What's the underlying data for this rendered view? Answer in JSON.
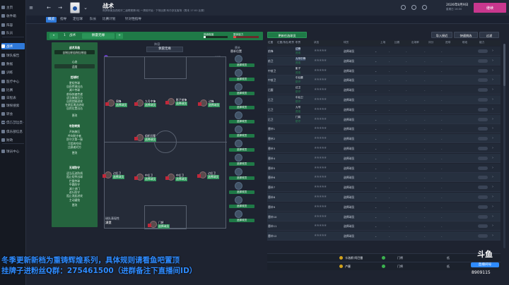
{
  "sidebar": {
    "items": [
      {
        "label": "主页",
        "active": false
      },
      {
        "label": "收件箱",
        "active": false
      },
      {
        "label": "阵容",
        "active": false
      },
      {
        "label": "队员",
        "active": false
      },
      {
        "label": "战术",
        "active": true
      },
      {
        "label": "球队报告",
        "active": false
      },
      {
        "label": "数据",
        "active": false
      },
      {
        "label": "训练",
        "active": false
      },
      {
        "label": "医疗中心",
        "active": false
      },
      {
        "label": "比赛",
        "active": false
      },
      {
        "label": "日程表",
        "active": false
      },
      {
        "label": "球探搜索",
        "active": false
      },
      {
        "label": "转会",
        "active": false
      },
      {
        "label": "俱乐部远景",
        "active": false
      },
      {
        "label": "俱乐部信息",
        "active": false
      },
      {
        "label": "财政",
        "active": false
      },
      {
        "label": "球员中心",
        "active": false
      }
    ]
  },
  "header": {
    "title": "战术",
    "subtitle": "佩罗斯莱加西班牙二级联赛第1轮 一周前开始 · 下场比赛 科尔多瓦客场（周末 17:00 比赛）",
    "date_main": "2026年8月9日",
    "date_sub": "星期日 16:00",
    "continue_label": "继续"
  },
  "subnav": {
    "tabs": [
      "概览",
      "指导",
      "定位球",
      "队长",
      "比赛计划",
      "针对性指导"
    ],
    "active_index": 0
  },
  "formbar": {
    "collapse_icon": "«",
    "slot_num": "1",
    "slot_name": "战术",
    "formation_label": "佩雷无缘",
    "add_icon": "+",
    "meter_label_1": "熟悉程度",
    "meter_label_2": "整体能力"
  },
  "left_panel": {
    "header": "战术风格",
    "subheader": "自制自制自制自制自",
    "mentality_label": "心态",
    "mentality_value": "适度",
    "with_ball_title": "控球时",
    "with_ball_items": [
      "更短传球",
      "自由传球出击",
      "减少传球",
      "前场快速传递",
      "适当施加压力",
      "自然控制进攻",
      "在禁区周边进攻",
      "自然位置出击"
    ],
    "edit_label": "更改",
    "transition_title": "攻防转换",
    "transition_items": [
      "开始施压",
      "传向防守者",
      "防守方第一接",
      "可用的空间",
      "比赛者对方"
    ],
    "out_of_possession_title": "无球防守",
    "out_of_possession_items": [
      "适当压迫防线",
      "阻止短传出球",
      "拦截传球",
      "中路防守",
      "减少进门",
      "进行防守",
      "阻止发起进攻",
      "主动逼抢"
    ]
  },
  "pitch": {
    "title": "阵容",
    "formation": "佩雷无缘",
    "players": [
      {
        "name": "周锋",
        "role": "选择球员",
        "badge": true
      },
      {
        "name": "九号中锋",
        "role": "选择球员",
        "badge": true
      },
      {
        "name": "影子前锋",
        "role": "选择球员",
        "badge": true
      },
      {
        "name": "边锋",
        "role": "选择球员",
        "badge": true
      },
      {
        "name": "组织后腰",
        "role": "选择球员",
        "badge": true
      },
      {
        "name": "边后卫",
        "role": "选择球员",
        "badge": true
      },
      {
        "name": "中后卫",
        "role": "选择球员",
        "badge": true
      },
      {
        "name": "中后卫",
        "role": "选择球员",
        "badge": true
      },
      {
        "name": "边后卫",
        "role": "选择球员",
        "badge": true
      },
      {
        "name": "门将",
        "role": "选择球员",
        "badge": true
      }
    ],
    "footer_label": "球队表现性",
    "footer_value": "满意",
    "checkbox_label": "说明"
  },
  "substitutes": {
    "title": "替补",
    "sub_title": "替补位置",
    "slots": [
      "选择球员",
      "选择球员",
      "选择球员",
      "选择球员",
      "选择球员",
      "选择球员",
      "选择球员",
      "选择球员",
      "选择球员",
      "选择球员",
      "选择球员",
      "选择球员"
    ]
  },
  "right_panel": {
    "toolbar": {
      "filter_label": "更新任选球员",
      "btn_1": "导入接近",
      "btn_2": "快速挑选",
      "btn_3": "过滤"
    },
    "columns": [
      "位置",
      "位置/角色/职责",
      "职责",
      "状态",
      "球员",
      "上场",
      "比赛",
      "出场率",
      "评分",
      "进球",
      "助攻",
      "能力"
    ],
    "rows": [
      {
        "pos": "前锋",
        "num": "",
        "name": "边锋",
        "role": "进攻",
        "select": "选择球员",
        "sel": true
      },
      {
        "pos": "前卫",
        "num": "",
        "name": "九号中锋",
        "role": "进攻",
        "select": "选择球员",
        "sel": true
      },
      {
        "pos": "中前卫",
        "num": "",
        "name": "影子",
        "role": "进攻",
        "select": "选择球员",
        "sel": false
      },
      {
        "pos": "中前卫",
        "num": "",
        "name": "中后腰",
        "role": "防守",
        "select": "选择球员",
        "sel": false
      },
      {
        "pos": "后腰",
        "num": "",
        "name": "边卫",
        "role": "防守",
        "select": "选择球员",
        "sel": false
      },
      {
        "pos": "后卫",
        "num": "",
        "name": "中后卫",
        "role": "防守",
        "select": "选择球员",
        "sel": false
      },
      {
        "pos": "后卫",
        "num": "",
        "name": "九号",
        "role": "进攻",
        "select": "选择球员",
        "sel": false
      },
      {
        "pos": "后卫",
        "num": "",
        "name": "门将",
        "role": "防守",
        "select": "选择球员",
        "sel": false
      },
      {
        "pos": "替补1",
        "num": "",
        "name": "",
        "role": "",
        "select": "选择球员",
        "sel": false
      },
      {
        "pos": "替补2",
        "num": "",
        "name": "",
        "role": "",
        "select": "选择球员",
        "sel": false
      },
      {
        "pos": "替补3",
        "num": "",
        "name": "",
        "role": "",
        "select": "选择球员",
        "sel": false
      },
      {
        "pos": "替补4",
        "num": "",
        "name": "",
        "role": "",
        "select": "选择球员",
        "sel": false
      },
      {
        "pos": "替补5",
        "num": "",
        "name": "",
        "role": "",
        "select": "选择球员",
        "sel": false
      },
      {
        "pos": "替补6",
        "num": "",
        "name": "",
        "role": "",
        "select": "选择球员",
        "sel": false
      },
      {
        "pos": "替补7",
        "num": "",
        "name": "",
        "role": "",
        "select": "选择球员",
        "sel": false
      },
      {
        "pos": "替补8",
        "num": "",
        "name": "",
        "role": "",
        "select": "选择球员",
        "sel": false
      },
      {
        "pos": "替补9",
        "num": "",
        "name": "",
        "role": "",
        "select": "选择球员",
        "sel": false
      },
      {
        "pos": "替补10",
        "num": "",
        "name": "",
        "role": "",
        "select": "选择球员",
        "sel": false
      },
      {
        "pos": "替补11",
        "num": "",
        "name": "",
        "role": "",
        "select": "选择球员",
        "sel": false
      },
      {
        "pos": "替补12",
        "num": "",
        "name": "",
        "role": "",
        "select": "选择球员",
        "sel": false
      }
    ],
    "bottom_rows": [
      {
        "num": "",
        "name": "卡洛斯·阿巴雷",
        "pos": "门将",
        "grade": "低"
      },
      {
        "num": "",
        "name": "卢塞",
        "pos": "门将",
        "grade": "低"
      }
    ]
  },
  "overlay": {
    "line1": "冬季更新新档为重铸辉煌系列，具体规则请看鱼吧置顶",
    "line2": "挂牌子进粉丝Q群：275461500（进群备注下直播间ID）",
    "logo_text": "斗鱼",
    "logo_sub": "直播间号",
    "room_id": "8909115"
  },
  "colors": {
    "accent": "#2f79d9",
    "green": "#1f7a47",
    "continue": "#c8378e",
    "overlay_text": "#2e8bff"
  }
}
